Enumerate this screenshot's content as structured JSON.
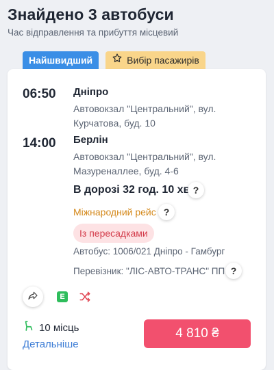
{
  "header": {
    "title": "Знайдено 3 автобуси",
    "subtitle": "Час відправлення та прибуття місцевий"
  },
  "badges": {
    "fastest": "Найшвидший",
    "choice": "Вибір пасажирів"
  },
  "trip": {
    "departure": {
      "time": "06:50",
      "city": "Дніпро",
      "address": "Автовокзал \"Центральний\", вул. Курчатова, буд. 10"
    },
    "arrival": {
      "time": "14:00",
      "city": "Берлін",
      "address": "Автовокзал \"Центральний\", вул. Мазуреналлее, буд. 4-6"
    },
    "duration": "В дорозі 32 год. 10 хв.",
    "international": "Міжнародний рейс",
    "transfer_tag": "Із пересадками",
    "bus": "Автобус: 1006/021 Дніпро - Гамбург",
    "carrier": "Перевізник: \"ЛІС-АВТО-ТРАНС\" ПП",
    "e_badge": "E",
    "seats": "10 місць",
    "details_link": "Детальніше",
    "price": "4 810 ₴"
  },
  "icons": {
    "star": "star-icon",
    "question": "question-icon",
    "share": "share-icon",
    "shuffle": "shuffle-icon",
    "seat": "seat-icon"
  },
  "colors": {
    "accent_blue": "#3a8ee6",
    "price_button": "#f2506e",
    "international": "#d4881a",
    "transfer": "#d33b4a",
    "e_ticket": "#2fbd5c"
  }
}
